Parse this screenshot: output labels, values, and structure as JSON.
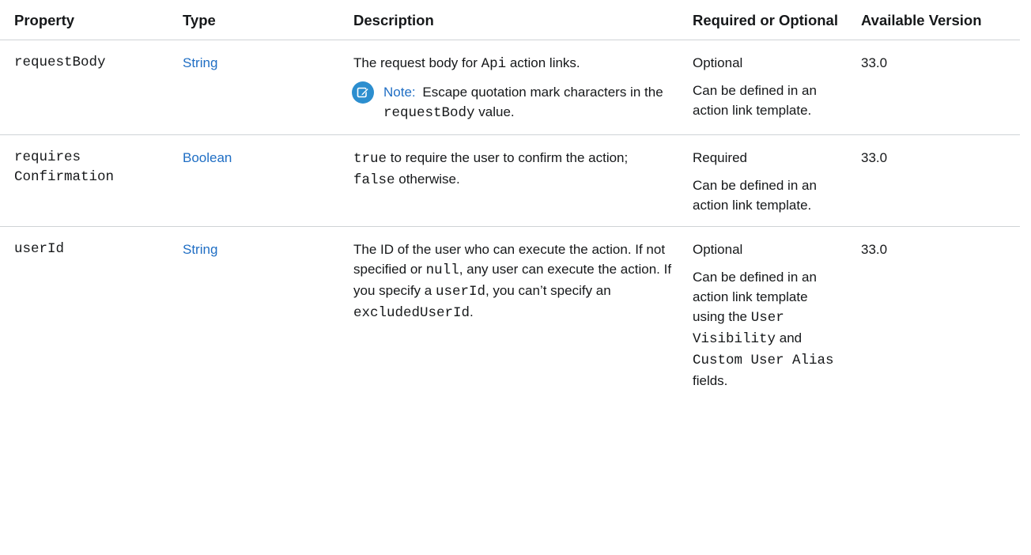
{
  "columns": {
    "property": "Property",
    "type": "Type",
    "description": "Description",
    "required": "Required or Optional",
    "version": "Available Version"
  },
  "rows": [
    {
      "property": "requestBody",
      "type": "String",
      "desc": {
        "pre": "The request body for ",
        "code1": "Api",
        "post": " action links."
      },
      "note": {
        "label": "Note:",
        "pre": "Escape quotation mark characters in the ",
        "code": "requestBody",
        "post": " value."
      },
      "required": "Optional",
      "required_detail": "Can be defined in an action link template.",
      "version": "33.0"
    },
    {
      "property_line1": "requires",
      "property_line2": "Confirmation",
      "type": "Boolean",
      "desc": {
        "code1": "true",
        "mid": " to require the user to confirm the action; ",
        "code2": "false",
        "post": " otherwise."
      },
      "required": "Required",
      "required_detail": "Can be defined in an action link template.",
      "version": "33.0"
    },
    {
      "property": "userId",
      "type": "String",
      "desc": {
        "t1": "The ID of the user who can execute the action. If not specified or ",
        "code1": "null",
        "t2": ", any user can execute the action. If you specify a ",
        "code2": "userId",
        "t3": ", you can’t specify an ",
        "code3": "excludedUserId",
        "t4": "."
      },
      "required": "Optional",
      "required_detail": {
        "t1": "Can be defined in an action link template using the ",
        "code1": "User Visibility",
        "t2": " and ",
        "code2": "Custom User Alias",
        "t3": " fields."
      },
      "version": "33.0"
    }
  ],
  "icons": {
    "note": "edit-pencil-icon"
  },
  "colors": {
    "link": "#1f6ec4",
    "note_icon": "#2c8ecf",
    "divider": "#cfd3d6",
    "text": "#16181a"
  }
}
